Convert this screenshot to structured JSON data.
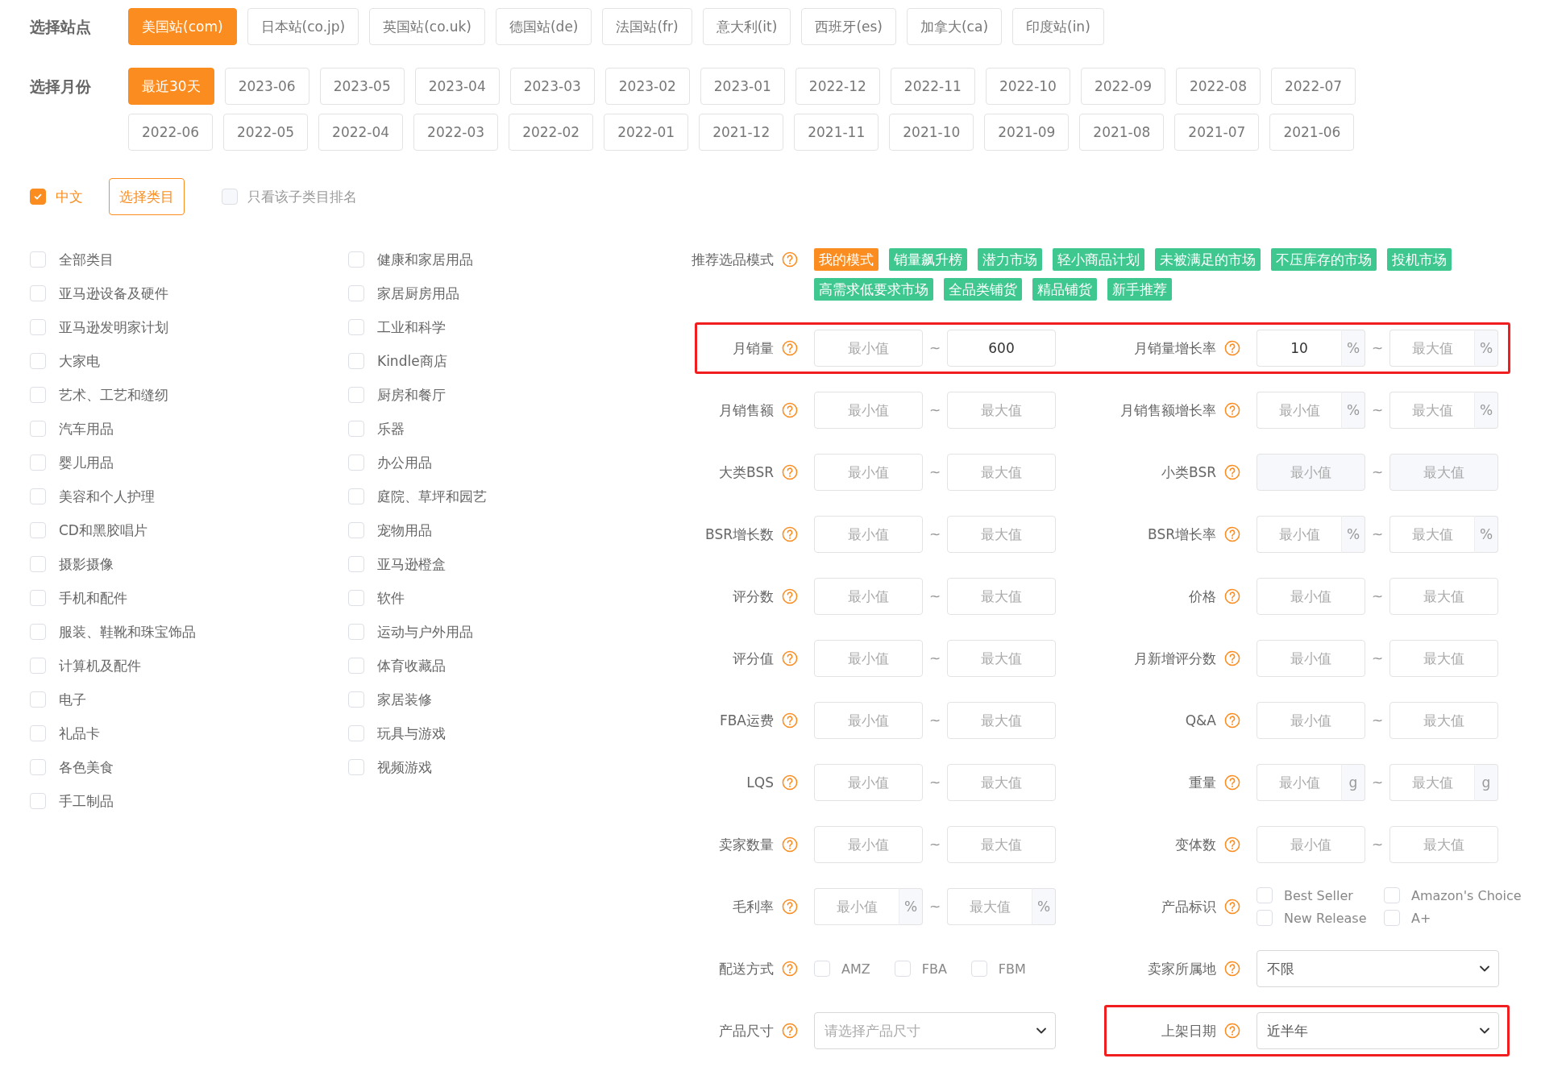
{
  "stations": {
    "label": "选择站点",
    "options": [
      {
        "label": "美国站(com)",
        "selected": true
      },
      {
        "label": "日本站(co.jp)",
        "selected": false
      },
      {
        "label": "英国站(co.uk)",
        "selected": false
      },
      {
        "label": "德国站(de)",
        "selected": false
      },
      {
        "label": "法国站(fr)",
        "selected": false
      },
      {
        "label": "意大利(it)",
        "selected": false
      },
      {
        "label": "西班牙(es)",
        "selected": false
      },
      {
        "label": "加拿大(ca)",
        "selected": false
      },
      {
        "label": "印度站(in)",
        "selected": false
      }
    ]
  },
  "months": {
    "label": "选择月份",
    "options": [
      {
        "label": "最近30天",
        "selected": true
      },
      {
        "label": "2023-06",
        "selected": false
      },
      {
        "label": "2023-05",
        "selected": false
      },
      {
        "label": "2023-04",
        "selected": false
      },
      {
        "label": "2023-03",
        "selected": false
      },
      {
        "label": "2023-02",
        "selected": false
      },
      {
        "label": "2023-01",
        "selected": false
      },
      {
        "label": "2022-12",
        "selected": false
      },
      {
        "label": "2022-11",
        "selected": false
      },
      {
        "label": "2022-10",
        "selected": false
      },
      {
        "label": "2022-09",
        "selected": false
      },
      {
        "label": "2022-08",
        "selected": false
      },
      {
        "label": "2022-07",
        "selected": false
      },
      {
        "label": "2022-06",
        "selected": false
      },
      {
        "label": "2022-05",
        "selected": false
      },
      {
        "label": "2022-04",
        "selected": false
      },
      {
        "label": "2022-03",
        "selected": false
      },
      {
        "label": "2022-02",
        "selected": false
      },
      {
        "label": "2022-01",
        "selected": false
      },
      {
        "label": "2021-12",
        "selected": false
      },
      {
        "label": "2021-11",
        "selected": false
      },
      {
        "label": "2021-10",
        "selected": false
      },
      {
        "label": "2021-09",
        "selected": false
      },
      {
        "label": "2021-08",
        "selected": false
      },
      {
        "label": "2021-07",
        "selected": false
      },
      {
        "label": "2021-06",
        "selected": false
      }
    ]
  },
  "language": {
    "label": "中文",
    "checked": true
  },
  "category_button": "选择类目",
  "subcategory_only": {
    "label": "只看该子类目排名",
    "checked": false
  },
  "categories": [
    {
      "label": "全部类目",
      "checked": false
    },
    {
      "label": "亚马逊设备及硬件",
      "checked": false
    },
    {
      "label": "亚马逊发明家计划",
      "checked": false
    },
    {
      "label": "大家电",
      "checked": false
    },
    {
      "label": "艺术、工艺和缝纫",
      "checked": false
    },
    {
      "label": "汽车用品",
      "checked": false
    },
    {
      "label": "婴儿用品",
      "checked": false
    },
    {
      "label": "美容和个人护理",
      "checked": false
    },
    {
      "label": "CD和黑胶唱片",
      "checked": false
    },
    {
      "label": "摄影摄像",
      "checked": false
    },
    {
      "label": "手机和配件",
      "checked": false
    },
    {
      "label": "服装、鞋靴和珠宝饰品",
      "checked": false
    },
    {
      "label": "计算机及配件",
      "checked": false
    },
    {
      "label": "电子",
      "checked": false
    },
    {
      "label": "礼品卡",
      "checked": false
    },
    {
      "label": "各色美食",
      "checked": false
    },
    {
      "label": "手工制品",
      "checked": false
    },
    {
      "label": "健康和家居用品",
      "checked": false
    },
    {
      "label": "家居厨房用品",
      "checked": false
    },
    {
      "label": "工业和科学",
      "checked": false
    },
    {
      "label": "Kindle商店",
      "checked": false
    },
    {
      "label": "厨房和餐厅",
      "checked": false
    },
    {
      "label": "乐器",
      "checked": false
    },
    {
      "label": "办公用品",
      "checked": false
    },
    {
      "label": "庭院、草坪和园艺",
      "checked": false
    },
    {
      "label": "宠物用品",
      "checked": false
    },
    {
      "label": "亚马逊橙盒",
      "checked": false
    },
    {
      "label": "软件",
      "checked": false
    },
    {
      "label": "运动与户外用品",
      "checked": false
    },
    {
      "label": "体育收藏品",
      "checked": false
    },
    {
      "label": "家居装修",
      "checked": false
    },
    {
      "label": "玩具与游戏",
      "checked": false
    },
    {
      "label": "视频游戏",
      "checked": false
    }
  ],
  "recommend": {
    "label": "推荐选品模式",
    "tags": [
      {
        "label": "我的模式",
        "selected": true
      },
      {
        "label": "销量飙升榜",
        "selected": false
      },
      {
        "label": "潜力市场",
        "selected": false
      },
      {
        "label": "轻小商品计划",
        "selected": false
      },
      {
        "label": "未被满足的市场",
        "selected": false
      },
      {
        "label": "不压库存的市场",
        "selected": false
      },
      {
        "label": "投机市场",
        "selected": false
      },
      {
        "label": "高需求低要求市场",
        "selected": false
      },
      {
        "label": "全品类铺货",
        "selected": false
      },
      {
        "label": "精品铺货",
        "selected": false
      },
      {
        "label": "新手推荐",
        "selected": false
      }
    ]
  },
  "filter_rows": [
    {
      "highlighted": true,
      "left": {
        "kind": "range",
        "label": "月销量",
        "min": {
          "placeholder": "最小值"
        },
        "separator": "~",
        "max": {
          "value": "600"
        }
      },
      "right": {
        "kind": "range",
        "label": "月销量增长率",
        "min": {
          "value": "10",
          "unit": "%"
        },
        "separator": "~",
        "max": {
          "placeholder": "最大值",
          "unit": "%"
        }
      }
    },
    {
      "highlighted": false,
      "left": {
        "kind": "range",
        "label": "月销售额",
        "min": {
          "placeholder": "最小值"
        },
        "separator": "~",
        "max": {
          "placeholder": "最大值"
        }
      },
      "right": {
        "kind": "range",
        "label": "月销售额增长率",
        "min": {
          "placeholder": "最小值",
          "unit": "%"
        },
        "separator": "~",
        "max": {
          "placeholder": "最大值",
          "unit": "%"
        }
      }
    },
    {
      "highlighted": false,
      "left": {
        "kind": "range",
        "label": "大类BSR",
        "min": {
          "placeholder": "最小值"
        },
        "separator": "~",
        "max": {
          "placeholder": "最大值"
        }
      },
      "right": {
        "kind": "range",
        "label": "小类BSR",
        "min": {
          "placeholder": "最小值",
          "disabled": true
        },
        "separator": "~",
        "max": {
          "placeholder": "最大值",
          "disabled": true
        }
      }
    },
    {
      "highlighted": false,
      "left": {
        "kind": "range",
        "label": "BSR增长数",
        "min": {
          "placeholder": "最小值"
        },
        "separator": "~",
        "max": {
          "placeholder": "最大值"
        }
      },
      "right": {
        "kind": "range",
        "label": "BSR增长率",
        "min": {
          "placeholder": "最小值",
          "unit": "%"
        },
        "separator": "~",
        "max": {
          "placeholder": "最大值",
          "unit": "%"
        }
      }
    },
    {
      "highlighted": false,
      "left": {
        "kind": "range",
        "label": "评分数",
        "min": {
          "placeholder": "最小值"
        },
        "separator": "~",
        "max": {
          "placeholder": "最大值"
        }
      },
      "right": {
        "kind": "range",
        "label": "价格",
        "min": {
          "placeholder": "最小值"
        },
        "separator": "~",
        "max": {
          "placeholder": "最大值"
        }
      }
    },
    {
      "highlighted": false,
      "left": {
        "kind": "range",
        "label": "评分值",
        "min": {
          "placeholder": "最小值"
        },
        "separator": "~",
        "max": {
          "placeholder": "最大值"
        }
      },
      "right": {
        "kind": "range",
        "label": "月新增评分数",
        "min": {
          "placeholder": "最小值"
        },
        "separator": "~",
        "max": {
          "placeholder": "最大值"
        }
      }
    },
    {
      "highlighted": false,
      "left": {
        "kind": "range",
        "label": "FBA运费",
        "min": {
          "placeholder": "最小值"
        },
        "separator": "~",
        "max": {
          "placeholder": "最大值"
        }
      },
      "right": {
        "kind": "range",
        "label": "Q&A",
        "min": {
          "placeholder": "最小值"
        },
        "separator": "~",
        "max": {
          "placeholder": "最大值"
        }
      }
    },
    {
      "highlighted": false,
      "left": {
        "kind": "range",
        "label": "LQS",
        "min": {
          "placeholder": "最小值"
        },
        "separator": "~",
        "max": {
          "placeholder": "最大值"
        }
      },
      "right": {
        "kind": "range",
        "label": "重量",
        "min": {
          "placeholder": "最小值",
          "unit": "g"
        },
        "separator": "~",
        "max": {
          "placeholder": "最大值",
          "unit": "g"
        }
      }
    },
    {
      "highlighted": false,
      "left": {
        "kind": "range",
        "label": "卖家数量",
        "min": {
          "placeholder": "最小值"
        },
        "separator": "~",
        "max": {
          "placeholder": "最大值"
        }
      },
      "right": {
        "kind": "range",
        "label": "变体数",
        "min": {
          "placeholder": "最小值"
        },
        "separator": "~",
        "max": {
          "placeholder": "最大值"
        }
      }
    },
    {
      "highlighted": false,
      "left": {
        "kind": "range",
        "label": "毛利率",
        "min": {
          "placeholder": "最小值",
          "unit": "%"
        },
        "separator": "~",
        "max": {
          "placeholder": "最大值",
          "unit": "%"
        }
      },
      "right": {
        "kind": "checks",
        "label": "产品标识",
        "options": [
          {
            "label": "Best Seller",
            "checked": false
          },
          {
            "label": "Amazon's Choice",
            "checked": false
          },
          {
            "label": "New Release",
            "checked": false
          },
          {
            "label": "A+",
            "checked": false
          }
        ]
      }
    },
    {
      "highlighted": false,
      "left": {
        "kind": "inline_checks",
        "label": "配送方式",
        "options": [
          {
            "label": "AMZ",
            "checked": false
          },
          {
            "label": "FBA",
            "checked": false
          },
          {
            "label": "FBM",
            "checked": false
          }
        ]
      },
      "right": {
        "kind": "select",
        "label": "卖家所属地",
        "value": "不限"
      }
    },
    {
      "highlighted": false,
      "left": {
        "kind": "select",
        "label": "产品尺寸",
        "placeholder": "请选择产品尺寸"
      },
      "right": {
        "kind": "select",
        "label": "上架日期",
        "value": "近半年",
        "highlighted": true
      }
    }
  ]
}
